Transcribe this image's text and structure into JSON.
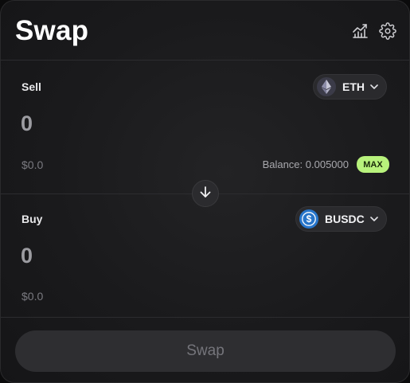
{
  "header": {
    "title": "Swap",
    "chart_icon": "chart-icon",
    "settings_icon": "gear-icon"
  },
  "sell": {
    "label": "Sell",
    "amount": "0",
    "usd_value": "$0.0",
    "balance_text": "Balance: 0.005000",
    "max_label": "MAX",
    "token": {
      "symbol": "ETH",
      "icon": "eth-icon"
    }
  },
  "flip_icon": "arrow-down-icon",
  "buy": {
    "label": "Buy",
    "amount": "0",
    "usd_value": "$0.0",
    "token": {
      "symbol": "BUSDC",
      "icon": "usdc-icon"
    }
  },
  "action": {
    "swap_label": "Swap"
  },
  "colors": {
    "background": "#1a1a1c",
    "accent_max": "#b8f27c",
    "usdc_blue": "#2775ca",
    "eth_badge": "#3b3b48"
  }
}
